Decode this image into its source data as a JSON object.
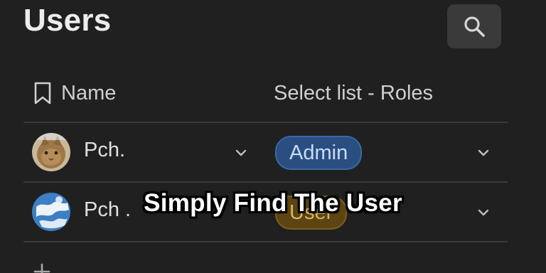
{
  "page": {
    "title": "Users"
  },
  "header": {
    "name_label": "Name",
    "roles_label": "Select list - Roles"
  },
  "users": [
    {
      "name": "Pch.",
      "role": "Admin",
      "avatar": "cat-photo-avatar"
    },
    {
      "name": "Pch .",
      "role": "User",
      "avatar": "earth-globe-avatar"
    }
  ],
  "overlay": {
    "caption": "Simply Find The User"
  },
  "colors": {
    "background": "#202020",
    "admin_pill": "#2a4e80",
    "user_pill": "#5c4512",
    "search_button": "#3a3a3a"
  },
  "icons": {
    "search": "search-icon",
    "bookmark": "bookmark-icon",
    "chevron": "chevron-down-icon",
    "add": "plus-icon"
  }
}
